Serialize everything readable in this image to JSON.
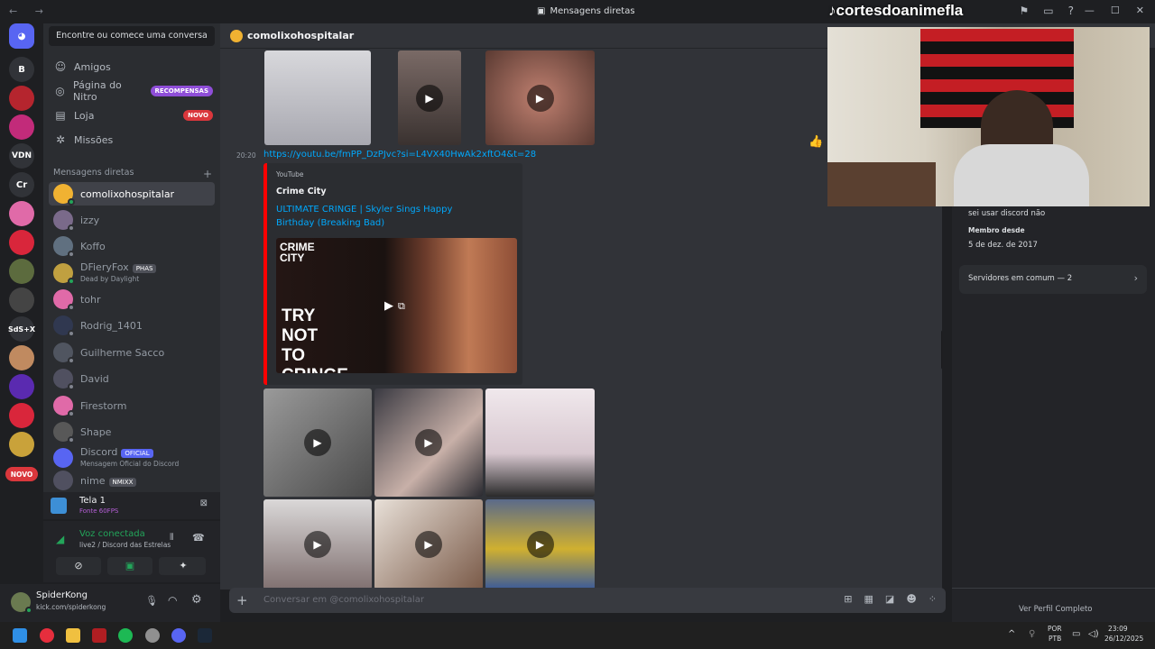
{
  "window": {
    "title": "Mensagens diretas",
    "nav_arrows": "← →"
  },
  "watermark": "cortesdoanimefla",
  "guilds": [
    {
      "label": "",
      "color": "#5865f2",
      "icon": "discord-logo"
    },
    {
      "label": "B",
      "color": "#313338"
    },
    {
      "label": "",
      "color": "#b5252e"
    },
    {
      "label": "",
      "color": "#c22b7a"
    },
    {
      "label": "VDN",
      "color": "#313338"
    },
    {
      "label": "Cr",
      "color": "#313338"
    },
    {
      "label": "",
      "color": "#e06aa8"
    },
    {
      "label": "",
      "color": "#d9263b"
    },
    {
      "label": "",
      "color": "#5c6b3e"
    },
    {
      "label": "",
      "color": "#444"
    },
    {
      "label": "SdS+X",
      "color": "#313338"
    },
    {
      "label": "",
      "color": "#c08a60"
    },
    {
      "label": "",
      "color": "#5a2ab0"
    },
    {
      "label": "",
      "color": "#d9263b"
    },
    {
      "label": "",
      "color": "#c9a23a"
    },
    {
      "label": "NOVO",
      "color": "#da373c"
    }
  ],
  "dm_sidebar": {
    "search_placeholder": "Encontre ou comece uma conversa",
    "nav": [
      {
        "label": "Amigos",
        "icon": "friends-icon"
      },
      {
        "label": "Página do Nitro",
        "icon": "nitro-icon",
        "badge": "RECOMPENSAS",
        "badge_color": "#8f4ed8"
      },
      {
        "label": "Loja",
        "icon": "shop-icon",
        "badge": "NOVO",
        "badge_color": "#da373c"
      },
      {
        "label": "Missões",
        "icon": "quests-icon"
      }
    ],
    "dm_header": "Mensagens diretas",
    "dm_add": "+",
    "dms": [
      {
        "name": "comolixohospitalar",
        "color": "#f0b232",
        "status": "#23a55a",
        "active": true
      },
      {
        "name": "izzy",
        "color": "#7a6a8a",
        "status": "#80848e"
      },
      {
        "name": "Koffo",
        "color": "#607080",
        "status": "#80848e"
      },
      {
        "name": "DFieryFox",
        "tag": "PHAS",
        "sub": "Dead by Daylight",
        "color": "#c0a040",
        "status": "#23a55a"
      },
      {
        "name": "tohr",
        "color": "#e06aa8",
        "status": "#80848e"
      },
      {
        "name": "Rodrig_1401",
        "color": "#303850",
        "status": "#80848e"
      },
      {
        "name": "Guilherme Sacco",
        "color": "#505560",
        "status": "#80848e"
      },
      {
        "name": "David",
        "color": "#505060",
        "status": "#80848e"
      },
      {
        "name": "Firestorm",
        "color": "#e06aa8",
        "status": "#80848e"
      },
      {
        "name": "Shape",
        "color": "#585858",
        "status": "#80848e"
      },
      {
        "name": "Discord",
        "tag": "OFICIAL",
        "sub": "Mensagem Oficial do Discord",
        "color": "#5865f2",
        "status": ""
      },
      {
        "name": "nime",
        "tag": "NMIXX",
        "color": "#505060",
        "status": ""
      }
    ]
  },
  "stream_panel": {
    "title": "Tela 1",
    "sub": "Fonte 60FPS"
  },
  "voice_panel": {
    "status": "Voz conectada",
    "channel": "live2 / Discord das Estrelas"
  },
  "user_panel": {
    "name": "SpiderKong",
    "sub": "kick.com/spiderkong"
  },
  "chat": {
    "title": "comolixohospitalar",
    "time": "20:20",
    "link": "https://youtu.be/fmPP_DzPJvc?si=L4VX40HwAk2xftO4&t=28",
    "embed": {
      "provider": "YouTube",
      "author": "Crime City",
      "title": "ULTIMATE CRINGE | Skyler Sings Happy Birthday (Breaking Bad)",
      "thumb_logo_1": "CRIME",
      "thumb_logo_2": "CITY",
      "thumb_text": "TRY NOT TO CRINGE"
    },
    "input_placeholder": "Conversar em @comolixohospitalar",
    "reaction": "👍"
  },
  "profile": {
    "bio": "sei usar discord não",
    "member_since_label": "Membro desde",
    "member_since": "5 de dez. de 2017",
    "mutual": "Servidores em comum — 2",
    "full_profile": "Ver Perfil Completo"
  },
  "taskbar": {
    "lang": "POR",
    "lang2": "PTB",
    "time": "23:09",
    "date": "26/12/2025"
  }
}
